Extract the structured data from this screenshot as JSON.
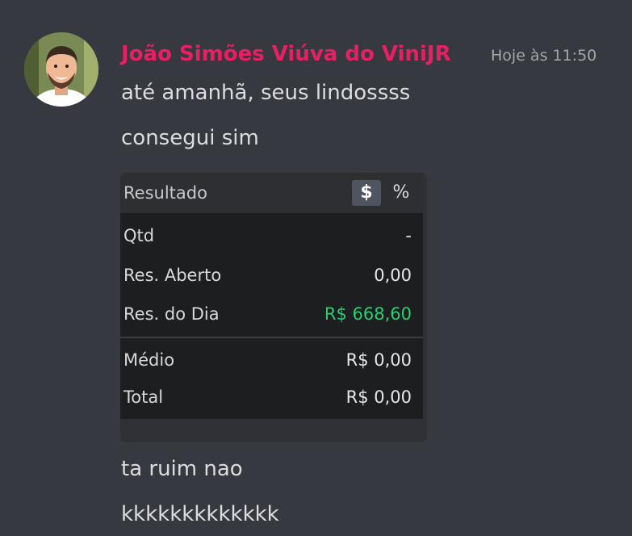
{
  "message": {
    "author": "João Simões Viúva do ViniJR",
    "timestamp": "Hoje às 11:50",
    "lines": [
      "até amanhã, seus lindossss",
      "consegui sim",
      "ta ruim nao",
      "kkkkkkkkkkkkk"
    ],
    "author_color": "#e91e63"
  },
  "result_panel": {
    "title": "Resultado",
    "currency_toggle": "$",
    "percent_toggle": "%",
    "rows": [
      {
        "label": "Qtd",
        "value": "-"
      },
      {
        "label": "Res. Aberto",
        "value": "0,00"
      },
      {
        "label": "Res. do Dia",
        "value": "R$ 668,60"
      },
      {
        "label": "Médio",
        "value": "R$ 0,00"
      },
      {
        "label": "Total",
        "value": "R$ 0,00"
      }
    ],
    "positive_color": "#2ecc71"
  }
}
